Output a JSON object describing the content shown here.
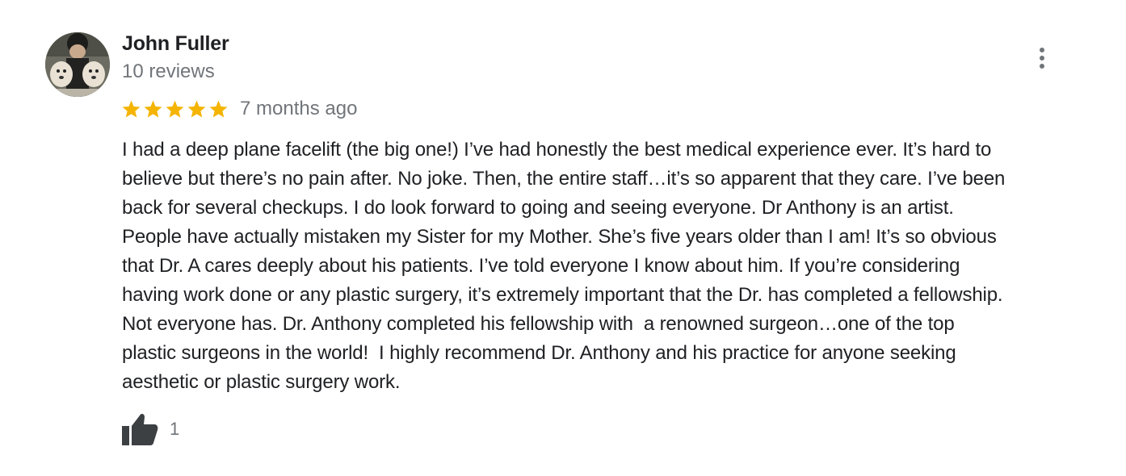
{
  "review": {
    "author": {
      "name": "John Fuller",
      "reviews_count_text": "10 reviews",
      "avatar_icon": "user-photo-avatar"
    },
    "rating": 5,
    "rating_max": 5,
    "date_text": "7 months ago",
    "text": "I had a deep plane facelift (the big one!) I’ve had honestly the best medical experience ever. It’s hard to\nbelieve but there’s no pain after. No joke. Then, the entire staff…it’s so apparent that they care. I’ve been\nback for several checkups. I do look forward to going and seeing everyone. Dr Anthony is an artist.\nPeople have actually mistaken my Sister for my Mother. She’s five years older than I am! It’s so obvious\nthat Dr. A cares deeply about his patients. I’ve told everyone I know about him. If you’re considering\nhaving work done or any plastic surgery, it’s extremely important that the Dr. has completed a fellowship.\nNot everyone has. Dr. Anthony completed his fellowship with  a renowned surgeon…one of the top\nplastic surgeons in the world!  I highly recommend Dr. Anthony and his practice for anyone seeking\naesthetic or plastic surgery work.",
    "likes": {
      "count": "1",
      "icon": "thumbs-up-icon"
    },
    "menu_icon": "more-vertical-icon"
  },
  "colors": {
    "name": "#202124",
    "secondary": "#70757a",
    "star": "#f4b400",
    "thumb": "#3c4043"
  }
}
